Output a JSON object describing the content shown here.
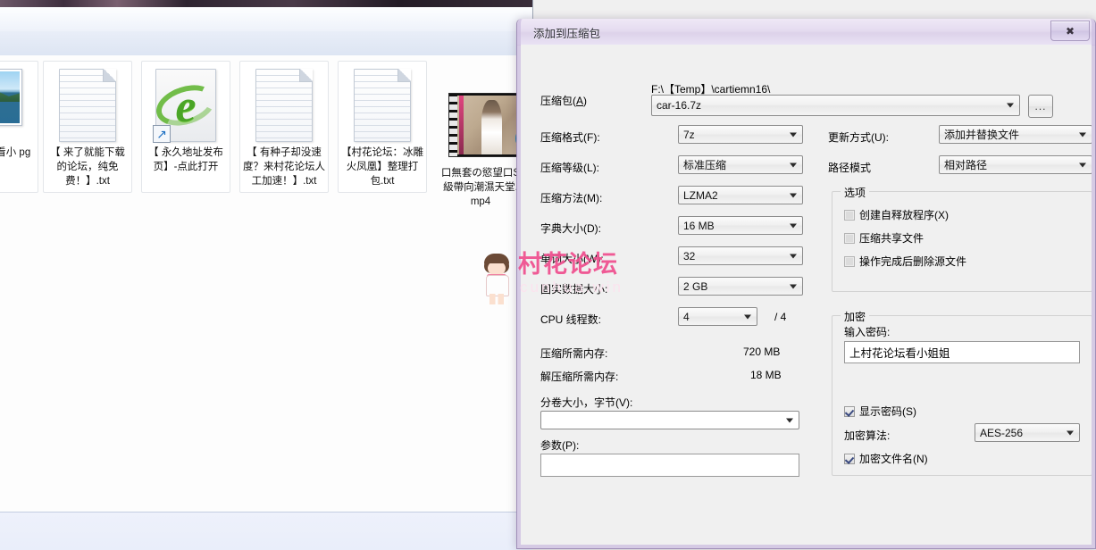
{
  "explorer": {
    "files": [
      {
        "name": "file-item-image",
        "icon": "image-icon",
        "caption": "码：】\n坛看小\npg"
      },
      {
        "name": "file-item-txt-1",
        "icon": "text-file-icon",
        "caption": "【 来了就能下载的论坛，纯免费！】.txt"
      },
      {
        "name": "file-item-ie",
        "icon": "ie-shortcut-icon",
        "caption": "【 永久地址发布页】-点此打开"
      },
      {
        "name": "file-item-txt-2",
        "icon": "text-file-icon",
        "caption": "【 有种子却没速度？来村花论坛人工加速！】.txt"
      },
      {
        "name": "file-item-txt-3",
        "icon": "text-file-icon",
        "caption": "【村花论坛：冰雕火凤凰】整理打包.txt"
      },
      {
        "name": "file-item-video",
        "icon": "video-file-icon",
        "caption": "口無套の慾望口S級帶向潮濕天堂.mp4"
      }
    ]
  },
  "watermark": {
    "text": "村花论坛",
    "sub": "cunhua.win"
  },
  "dialog": {
    "title": "添加到压缩包",
    "close_label": "✖",
    "archive": {
      "label": "压缩包(A)",
      "label_main": "压缩包",
      "accel": "A",
      "path": "F:\\【Temp】\\cartiemn16\\",
      "filename": "car-16.7z",
      "browse_label": "..."
    },
    "left": {
      "format_label": "压缩格式(F):",
      "format_value": "7z",
      "level_label": "压缩等级(L):",
      "level_value": "标准压缩",
      "method_label": "压缩方法(M):",
      "method_value": "LZMA2",
      "dict_label": "字典大小(D):",
      "dict_value": "16 MB",
      "word_label": "单词大小(W):",
      "word_value": "32",
      "solid_label": "固实数据大小:",
      "solid_value": "2 GB",
      "cpu_label": "CPU 线程数:",
      "cpu_value": "4",
      "cpu_max": "/ 4",
      "mem_compress_label": "压缩所需内存:",
      "mem_compress_value": "720 MB",
      "mem_decompress_label": "解压缩所需内存:",
      "mem_decompress_value": "18 MB",
      "split_label": "分卷大小，字节(V):",
      "split_value": "",
      "params_label": "参数(P):",
      "params_value": ""
    },
    "right": {
      "update_label": "更新方式(U):",
      "update_value": "添加并替换文件",
      "path_mode_label": "路径模式",
      "path_mode_value": "相对路径",
      "options_group": "选项",
      "options": [
        {
          "label": "创建自释放程序(X)",
          "checked": false
        },
        {
          "label": "压缩共享文件",
          "checked": false
        },
        {
          "label": "操作完成后删除源文件",
          "checked": false
        }
      ],
      "encrypt_group": "加密",
      "password_label": "输入密码:",
      "password_value": "上村花论坛看小姐姐",
      "show_password_label": "显示密码(S)",
      "show_password_checked": true,
      "algo_label": "加密算法:",
      "algo_value": "AES-256",
      "encrypt_names_label": "加密文件名(N)",
      "encrypt_names_checked": true
    }
  }
}
